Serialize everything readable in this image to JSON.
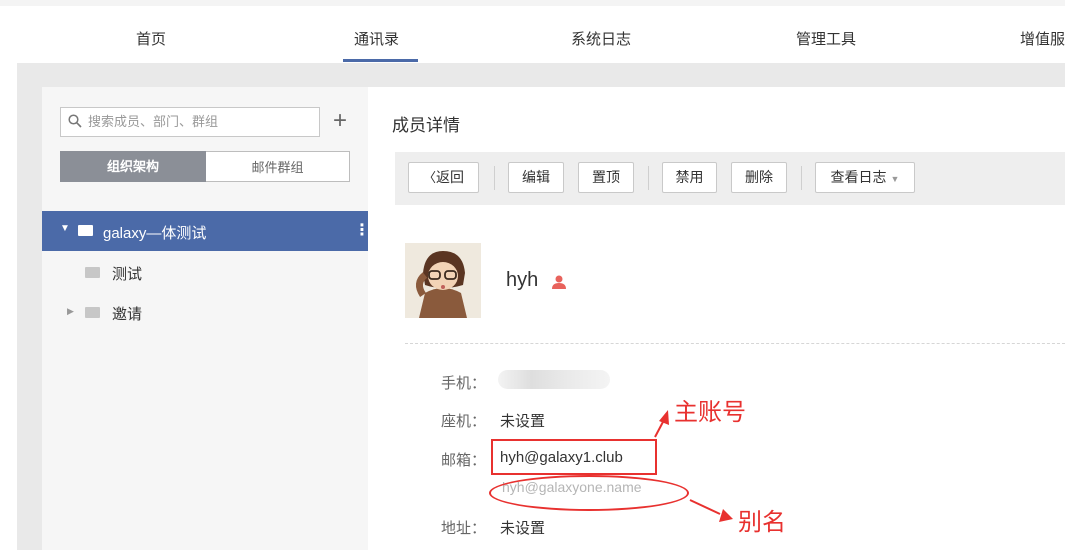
{
  "nav": {
    "items": [
      "首页",
      "通讯录",
      "系统日志",
      "管理工具",
      "增值服"
    ],
    "active_index": 1
  },
  "sidebar": {
    "search_placeholder": "搜索成员、部门、群组",
    "add_symbol": "+",
    "tabs": [
      "组织架构",
      "邮件群组"
    ],
    "tree": [
      {
        "label": "galaxy—体测试",
        "expanded": true,
        "selected": true
      },
      {
        "label": "测试"
      },
      {
        "label": "邀请",
        "expandable": true
      }
    ]
  },
  "main": {
    "title": "成员详情",
    "toolbar": {
      "back": "返回",
      "edit": "编辑",
      "pin": "置顶",
      "disable": "禁用",
      "delete": "删除",
      "view_log": "查看日志"
    },
    "user": {
      "name": "hyh"
    },
    "fields": {
      "phone_label": "手机：",
      "landline_label": "座机：",
      "landline_value": "未设置",
      "email_label": "邮箱：",
      "email_value": "hyh@galaxy1.club",
      "email_alias": "hyh@galaxyone.name",
      "address_label": "地址：",
      "address_value": "未设置"
    }
  },
  "annotations": {
    "primary_account": "主账号",
    "alias": "别名",
    "color": "#e8312f"
  },
  "colors": {
    "accent": "#4b6aa8"
  }
}
